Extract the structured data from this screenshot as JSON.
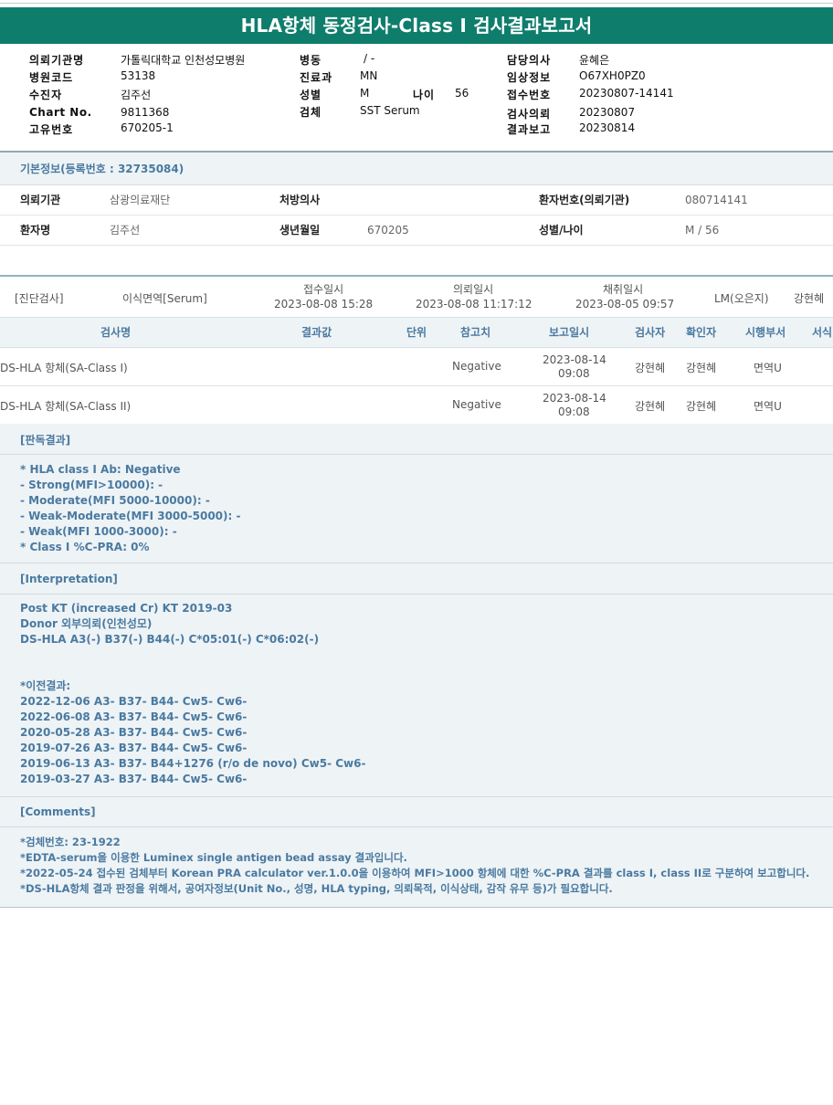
{
  "report_title": "HLA항체 동정검사-Class I 검사결과보고서",
  "header": {
    "col1": [
      {
        "label": "의뢰기관명",
        "value": "가톨릭대학교 인천성모병원"
      },
      {
        "label": "병원코드",
        "value": "53138"
      },
      {
        "label": "수진자",
        "value": "김주선"
      },
      {
        "label": "Chart No.",
        "value": "9811368"
      },
      {
        "label": "고유번호",
        "value": "670205-1"
      }
    ],
    "col2": [
      {
        "label": "병동",
        "value": "/ -"
      },
      {
        "label": "진료과",
        "value": "MN"
      },
      {
        "label": "성별",
        "value": "M"
      },
      {
        "label": "검체",
        "value": "SST Serum"
      }
    ],
    "age_label": "나이",
    "age_value": "56",
    "col3": [
      {
        "label": "담당의사",
        "value": "윤혜은"
      },
      {
        "label": "임상정보",
        "value": "O67XH0PZ0"
      },
      {
        "label": "접수번호",
        "value": "20230807-14141"
      },
      {
        "label": "검사의뢰",
        "value": "20230807"
      },
      {
        "label": "결과보고",
        "value": "20230814"
      }
    ]
  },
  "basic_info": {
    "title": "기본정보(등록번호 : 32735084)",
    "row1": {
      "inst_label": "의뢰기관",
      "inst_value": "삼광의료재단",
      "doctor_label": "처방의사",
      "doctor_value": "",
      "pid_label": "환자번호(의뢰기관)",
      "pid_value": "080714141"
    },
    "row2": {
      "name_label": "환자명",
      "name_value": "김주선",
      "dob_label": "생년월일",
      "dob_value": "670205",
      "sexage_label": "성별/나이",
      "sexage_value": "M / 56"
    }
  },
  "order": {
    "category": "[진단검사]",
    "test": "이식면역[Serum]",
    "received_label": "접수일시",
    "received_value": "2023-08-08 15:28",
    "requested_label": "의뢰일시",
    "requested_value": "2023-08-08 11:17:12",
    "collected_label": "채취일시",
    "collected_value": "2023-08-05 09:57",
    "lab": "LM(오은지)",
    "tech": "강현혜"
  },
  "results": {
    "columns": [
      "검사명",
      "결과값",
      "단위",
      "참고치",
      "보고일시",
      "검사자",
      "확인자",
      "시행부서",
      "서식"
    ],
    "rows": [
      {
        "name": "DS-HLA 항체(SA-Class I)",
        "result": "",
        "unit": "",
        "ref": "Negative",
        "report_date": "2023-08-14",
        "report_time": "09:08",
        "tester": "강현혜",
        "verifier": "강현혜",
        "dept": "면역U"
      },
      {
        "name": "DS-HLA 항체(SA-Class II)",
        "result": "",
        "unit": "",
        "ref": "Negative",
        "report_date": "2023-08-14",
        "report_time": "09:08",
        "tester": "강현혜",
        "verifier": "강현혜",
        "dept": "면역U"
      }
    ]
  },
  "judgement": {
    "title": "[판독결과]",
    "lines": [
      "* HLA class I Ab: Negative",
      "- Strong(MFI>10000): -",
      "- Moderate(MFI 5000-10000): -",
      "- Weak-Moderate(MFI 3000-5000): -",
      "- Weak(MFI 1000-3000): -",
      "* Class I %C-PRA: 0%"
    ]
  },
  "interpretation": {
    "title": "[Interpretation]",
    "lines": [
      "Post KT (increased Cr) KT 2019-03",
      "Donor 외부의뢰(인천성모)",
      "DS-HLA A3(-) B37(-) B44(-) C*05:01(-) C*06:02(-)",
      "",
      "",
      "*이전결과:",
      "2022-12-06 A3- B37- B44- Cw5- Cw6-",
      "2022-06-08 A3- B37- B44- Cw5- Cw6-",
      "2020-05-28 A3- B37- B44- Cw5- Cw6-",
      "2019-07-26 A3- B37- B44- Cw5- Cw6-",
      "2019-06-13 A3- B37- B44+1276 (r/o de novo) Cw5- Cw6-",
      "2019-03-27 A3- B37- B44- Cw5- Cw6-"
    ]
  },
  "comments": {
    "title": "[Comments]",
    "lines": [
      "*검체번호: 23-1922",
      "*EDTA-serum을 이용한 Luminex single antigen bead assay 결과입니다.",
      "*2022-05-24 접수된 검체부터 Korean PRA calculator ver.1.0.0을 이용하여 MFI>1000 항체에 대한 %C-PRA 결과를 class I, class II로 구분하여 보고합니다.",
      "*DS-HLA항체 결과 판정을 위해서, 공여자정보(Unit No., 성명, HLA typing, 의뢰목적, 이식상태, 감작 유무 등)가 필요합니다."
    ]
  }
}
